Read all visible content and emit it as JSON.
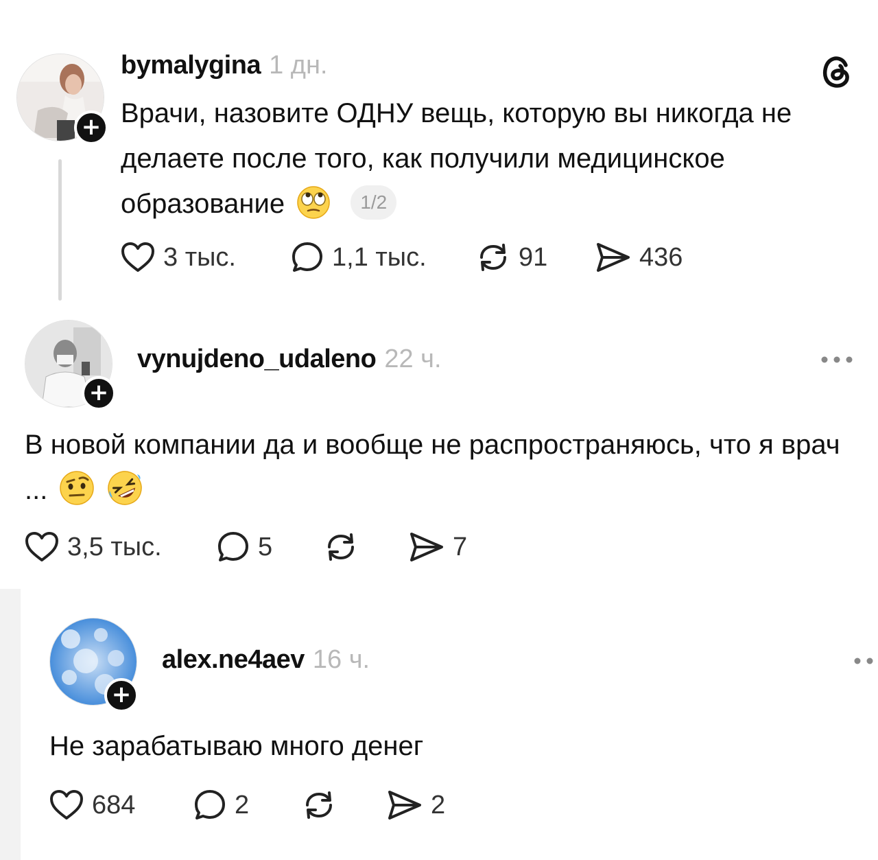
{
  "posts": [
    {
      "username": "bymalygina",
      "time": "1 дн.",
      "text": "Врачи, назовите ОДНУ вещь, которую вы никогда не делаете после того, как получили медицинское образование",
      "page_indicator": "1/2",
      "likes": "3 тыс.",
      "replies": "1,1 тыс.",
      "reposts": "91",
      "shares": "436",
      "corner_icon": "threads-logo-icon"
    },
    {
      "username": "vynujdeno_udaleno",
      "time": "22 ч.",
      "text": "В новой компании да и вообще не распространяюсь, что я врач ...",
      "likes": "3,5 тыс.",
      "replies": "5",
      "reposts": "",
      "shares": "7",
      "corner_icon": "more-options-icon"
    },
    {
      "username": "alex.ne4aev",
      "time": "16 ч.",
      "text": "Не зарабатываю много денег",
      "likes": "684",
      "replies": "2",
      "reposts": "",
      "shares": "2",
      "corner_icon": "more-options-icon"
    }
  ],
  "colors": {
    "text": "#111111",
    "muted": "#b8b8b8",
    "background": "#ffffff",
    "page_background": "#f2f2f2"
  }
}
